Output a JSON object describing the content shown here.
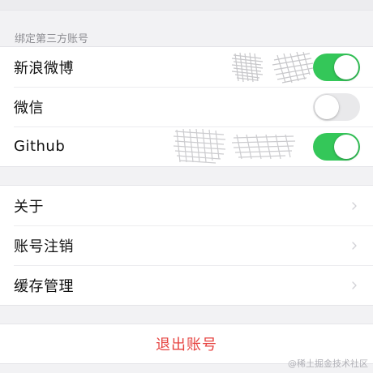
{
  "section_header": "绑定第三方账号",
  "accounts": [
    {
      "label": "新浪微博",
      "toggle": "on"
    },
    {
      "label": "微信",
      "toggle": "off"
    },
    {
      "label": "Github",
      "toggle": "on"
    }
  ],
  "menu_items": [
    {
      "label": "关于",
      "icon": "chevron-right-icon"
    },
    {
      "label": "账号注销",
      "icon": "chevron-right-icon"
    },
    {
      "label": "缓存管理",
      "icon": "chevron-right-icon"
    }
  ],
  "logout_label": "退出账号",
  "watermark": "@稀土掘金技术社区",
  "colors": {
    "toggle_on": "#34c759",
    "toggle_off": "#e9e9eb",
    "logout_text": "#e64340",
    "section_header_text": "#8e8e93",
    "page_background": "#f2f2f4"
  }
}
